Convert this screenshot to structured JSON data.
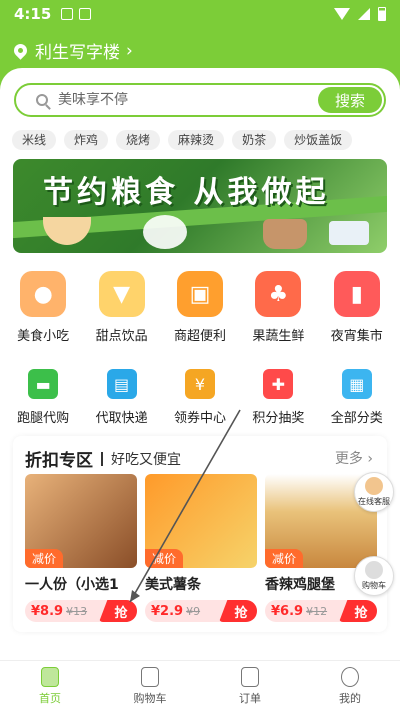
{
  "status_bar": {
    "time": "4:15"
  },
  "location": {
    "label": "利生写字楼",
    "chevron": "›"
  },
  "search": {
    "placeholder": "美味享不停",
    "button_label": "搜索"
  },
  "hot_tags": [
    "米线",
    "炸鸡",
    "烧烤",
    "麻辣烫",
    "奶茶",
    "炒饭盖饭"
  ],
  "banner": {
    "title": "节约粮食  从我做起"
  },
  "categories_row1": [
    {
      "label": "美食小吃",
      "icon": "food-icon",
      "color": "#ffb36b"
    },
    {
      "label": "甜点饮品",
      "icon": "drink-icon",
      "color": "#ffd36b"
    },
    {
      "label": "商超便利",
      "icon": "shopping-bag-icon",
      "color": "#ff9f2e"
    },
    {
      "label": "果蔬生鲜",
      "icon": "vegetable-icon",
      "color": "#ff6a4a"
    },
    {
      "label": "夜宵集市",
      "icon": "fries-icon",
      "color": "#ff5a5a"
    }
  ],
  "categories_row2": [
    {
      "label": "跑腿代购",
      "icon": "delivery-truck-icon",
      "color": "#3cbf4a"
    },
    {
      "label": "代取快递",
      "icon": "package-icon",
      "color": "#2aa8e8"
    },
    {
      "label": "领券中心",
      "icon": "coupon-icon",
      "color": "#f5a623"
    },
    {
      "label": "积分抽奖",
      "icon": "prize-bag-icon",
      "color": "#ff4a4a"
    },
    {
      "label": "全部分类",
      "icon": "grid-icon",
      "color": "#3cb5f0"
    }
  ],
  "discount": {
    "title": "折扣专区",
    "subtitle": "好吃又便宜",
    "more_label": "更多 ›",
    "products": [
      {
        "name": "一人份（小选1",
        "tag": "减价",
        "price": "¥8.9",
        "old_price": "¥13",
        "grab": "抢",
        "color": "#b07a4a"
      },
      {
        "name": "美式薯条",
        "tag": "减价",
        "price": "¥2.9",
        "old_price": "¥9",
        "grab": "抢",
        "color": "#f4a02a"
      },
      {
        "name": "香辣鸡腿堡",
        "tag": "减价",
        "price": "¥6.9",
        "old_price": "¥12",
        "grab": "抢",
        "color": "#e8c07a"
      }
    ]
  },
  "floating": {
    "service_label": "在线客服",
    "cart_label": "购物车"
  },
  "tabs": [
    {
      "label": "首页",
      "icon": "home-icon"
    },
    {
      "label": "购物车",
      "icon": "cart-icon"
    },
    {
      "label": "订单",
      "icon": "order-icon"
    },
    {
      "label": "我的",
      "icon": "profile-icon"
    }
  ],
  "colors": {
    "accent": "#7ccd38",
    "price": "#ff2a2a",
    "tag": "#ff6b2c"
  }
}
